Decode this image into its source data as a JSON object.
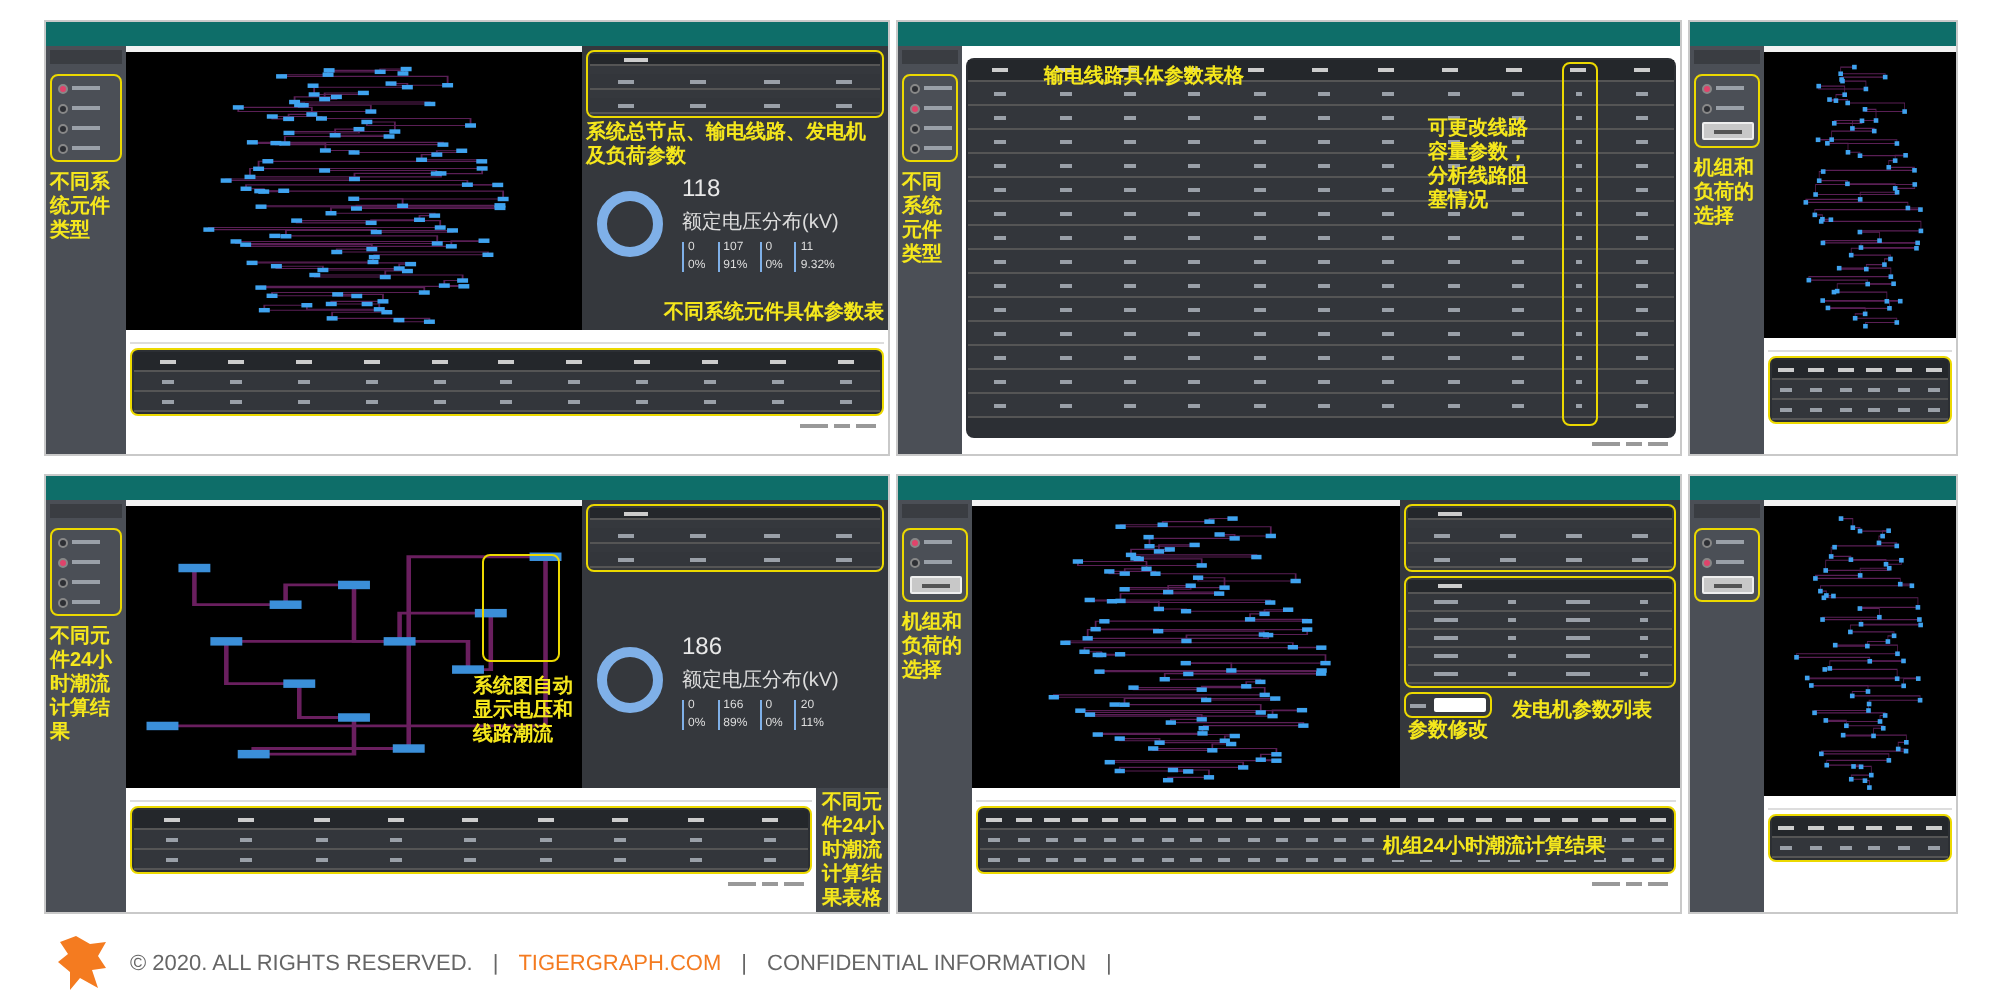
{
  "screenshots": [
    {
      "kind": "overview",
      "radios": [
        {
          "selected": true
        },
        {
          "selected": false
        },
        {
          "selected": false
        },
        {
          "selected": false
        }
      ],
      "sidebar_note": "不同系统元件类型",
      "summary_note": "系统总节点、输电线路、发电机及负荷参数",
      "stats": {
        "total": "118",
        "caption": "额定电压分布(kV)",
        "groups": [
          {
            "count": "0",
            "percent": "0%"
          },
          {
            "count": "107",
            "percent": "91%"
          },
          {
            "count": "0",
            "percent": "0%"
          },
          {
            "count": "11",
            "percent": "9.32%"
          }
        ]
      },
      "panel_note": "不同系统元件具体参数表"
    },
    {
      "kind": "line_table",
      "radios": [
        {
          "selected": false
        },
        {
          "selected": true
        },
        {
          "selected": false
        },
        {
          "selected": false
        }
      ],
      "sidebar_note": "不同系统元件类型",
      "table_note": "输电线路具体参数表格",
      "column_note": "可更改线路容量参数，分析线路阻塞情况"
    },
    {
      "kind": "unit_hours",
      "radios": [
        {
          "selected": true
        },
        {
          "selected": false
        }
      ],
      "sidebar_note": "机组和负荷的选择"
    },
    {
      "kind": "flow",
      "radios": [
        {
          "selected": false
        },
        {
          "selected": true
        },
        {
          "selected": false
        },
        {
          "selected": false
        }
      ],
      "sidebar_note": "不同元件24小时潮流计算结果",
      "graph_note": "系统图自动显示电压和线路潮流",
      "stats": {
        "total": "186",
        "caption": "额定电压分布(kV)",
        "groups": [
          {
            "count": "0",
            "percent": "0%"
          },
          {
            "count": "166",
            "percent": "89%"
          },
          {
            "count": "0",
            "percent": "0%"
          },
          {
            "count": "20",
            "percent": "11%"
          }
        ]
      },
      "table_note": "不同元件24小时潮流计算结果表格"
    },
    {
      "kind": "generator",
      "radios": [
        {
          "selected": true
        },
        {
          "selected": false
        }
      ],
      "sidebar_note": "机组和负荷的选择",
      "params_note": "发电机参数列表",
      "select_note": "参数修改",
      "table_note": "机组24小时潮流计算结果"
    },
    {
      "kind": "load_hours",
      "radios": [
        {
          "selected": false
        },
        {
          "selected": true
        }
      ]
    }
  ],
  "footer": {
    "copyright": "© 2020. ALL RIGHTS RESERVED.",
    "separator": "|",
    "site": "TIGERGRAPH.COM",
    "notice": "CONFIDENTIAL INFORMATION"
  }
}
